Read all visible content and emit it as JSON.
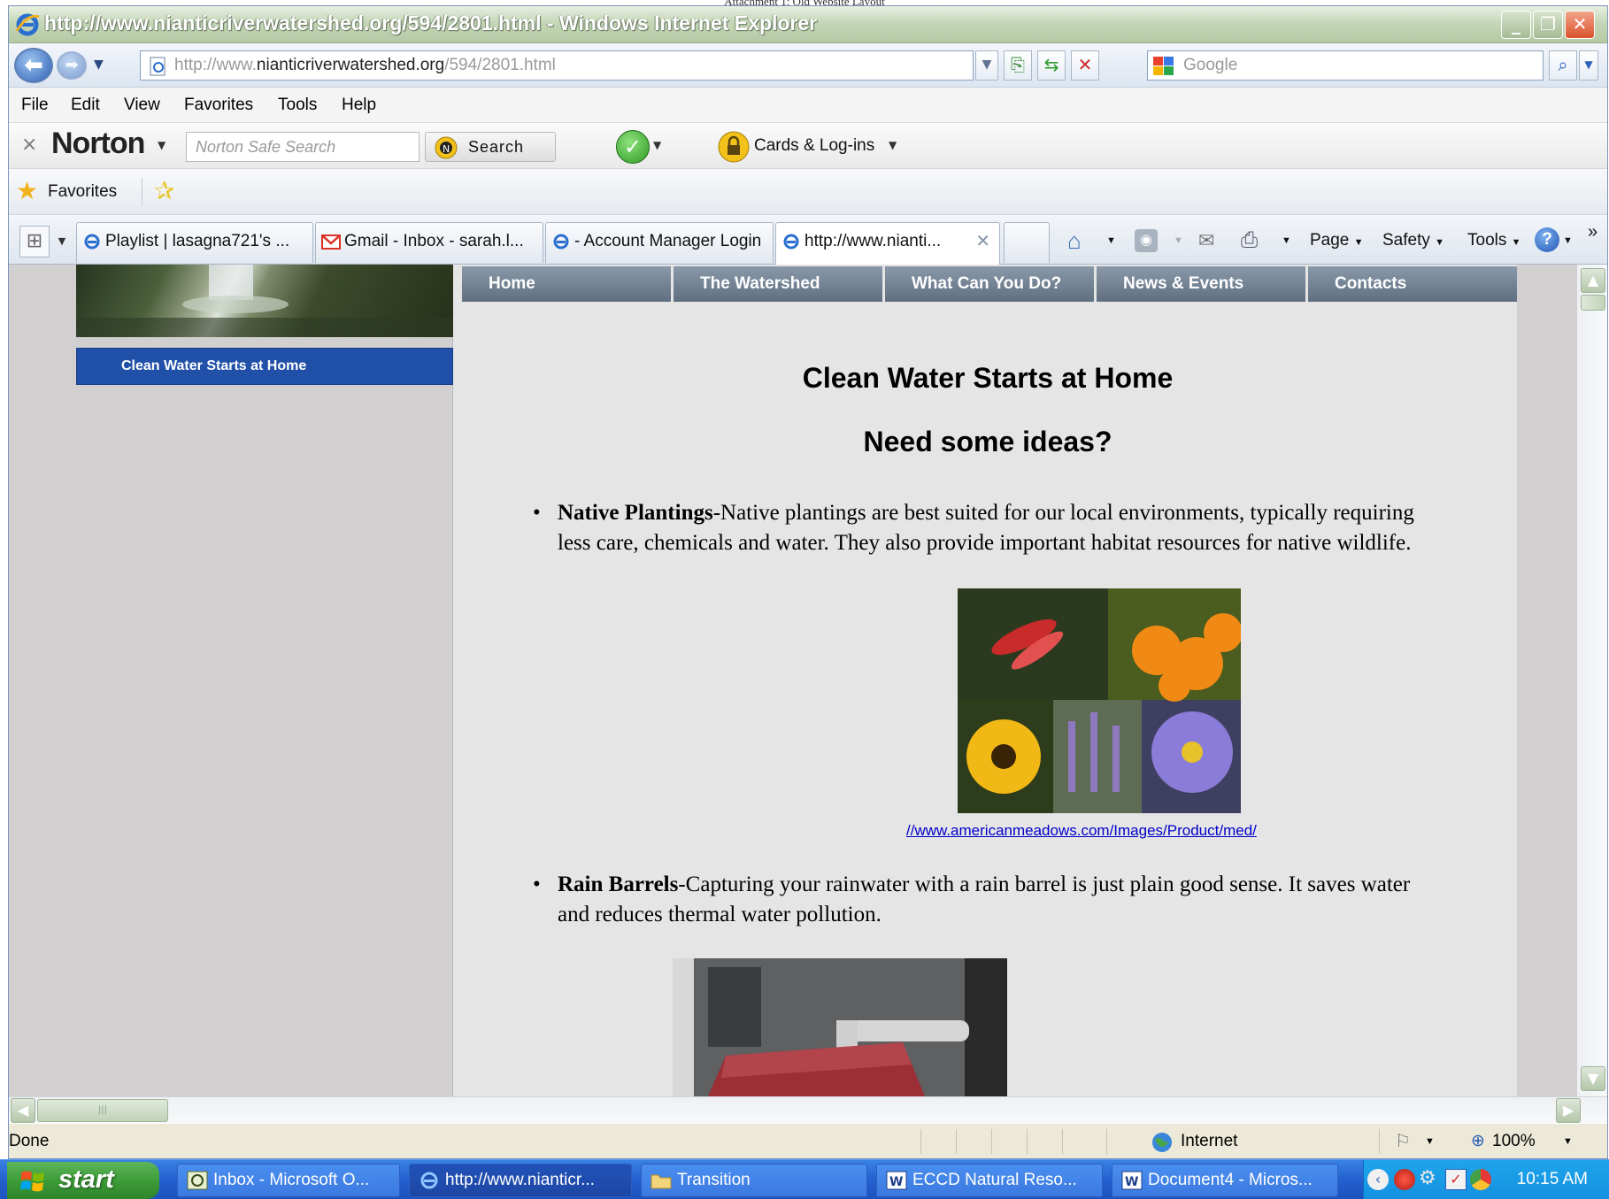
{
  "document_header": "Attachment 1: Old Website Layout",
  "window": {
    "title": "http://www.nianticriverwatershed.org/594/2801.html - Windows Internet Explorer"
  },
  "address_bar": {
    "url_prefix": "http://www.",
    "url_domain": "nianticriverwatershed.org",
    "url_path": "/594/2801.html"
  },
  "search_box": {
    "placeholder": "Google"
  },
  "menu": [
    "File",
    "Edit",
    "View",
    "Favorites",
    "Tools",
    "Help"
  ],
  "norton": {
    "brand": "Norton",
    "search_placeholder": "Norton Safe Search",
    "search_button": "Search",
    "cards_label": "Cards & Log-ins"
  },
  "favorites_label": "Favorites",
  "tabs": [
    {
      "label": "Playlist | lasagna721's ..."
    },
    {
      "label": "Gmail - Inbox - sarah.l..."
    },
    {
      "label": "- Account Manager Login"
    },
    {
      "label": "http://www.nianti..."
    }
  ],
  "command_bar": {
    "page": "Page",
    "safety": "Safety",
    "tools": "Tools"
  },
  "site": {
    "left_nav": [
      "Clean Water Starts at Home"
    ],
    "top_nav": [
      "Home",
      "The Watershed",
      "What Can You Do?",
      "News & Events",
      "Contacts"
    ],
    "heading": "Clean Water Starts at Home",
    "subheading": "Need some ideas?",
    "items": [
      {
        "title": "Native Plantings",
        "line1": "-Native plantings are best suited for our local environments, typically requiring",
        "line2": "less care, chemicals and water.  They also provide important habitat resources for native wildlife."
      },
      {
        "title": "Rain Barrels",
        "line1": "-Capturing your rainwater with a rain barrel is just plain good sense.  It saves water",
        "line2": "and reduces thermal water pollution."
      }
    ],
    "image_link": "//www.americanmeadows.com/Images/Product/med/"
  },
  "status": {
    "text": "Done",
    "zone": "Internet",
    "zoom": "100%"
  },
  "taskbar": {
    "start": "start",
    "tasks": [
      {
        "label": "Inbox - Microsoft O..."
      },
      {
        "label": "http://www.nianticr..."
      },
      {
        "label": "Transition"
      },
      {
        "label": "ECCD Natural Reso..."
      },
      {
        "label": "Document4 - Micros..."
      }
    ],
    "clock": "10:15 AM"
  }
}
